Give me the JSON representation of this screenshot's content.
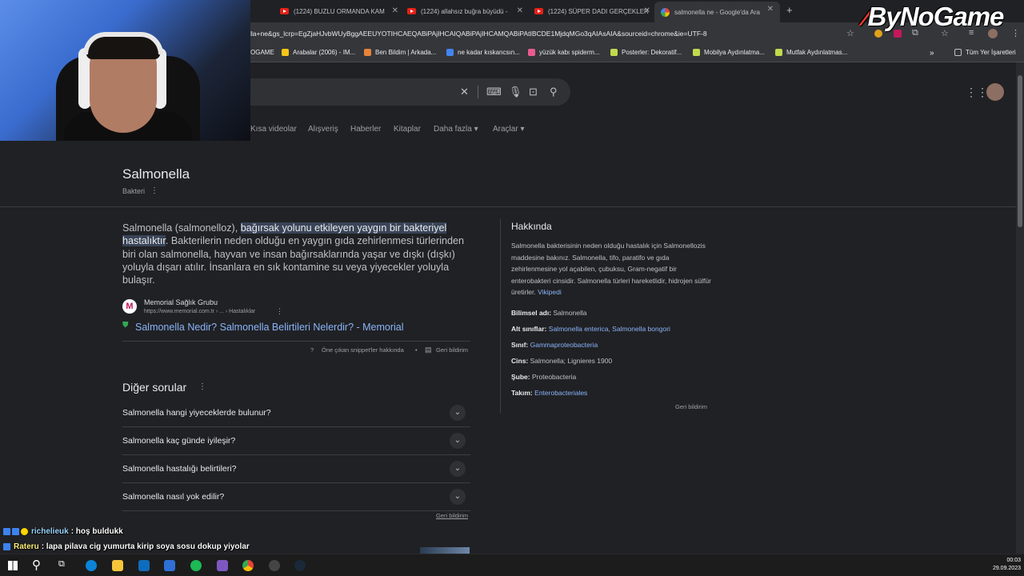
{
  "browser": {
    "tabs": [
      {
        "label": "(1224) BUZLU ORMANDA KAM"
      },
      {
        "label": "(1224) allahsız buğra büyüdü - "
      },
      {
        "label": "(1224) SÜPER DADI GERÇEKLER"
      },
      {
        "label": "salmonella ne - Google'da Ara"
      }
    ],
    "new_tab": "+",
    "url": "lla+ne&gs_lcrp=EgZjaHJvbWUyBggAEEUYOTIHCAEQABiPAjIHCAIQABiPAjIHCAMQABiPAtIBCDE1MjdqMGo3qAIAsAIA&sourceid=chrome&ie=UTF-8",
    "bookmarks": [
      {
        "label": "OGAME",
        "color": "#4a4b4e"
      },
      {
        "label": "Arabalar (2006) - IM...",
        "color": "#f5c518"
      },
      {
        "label": "Ben Bildim | Arkada...",
        "color": "#e8833a"
      },
      {
        "label": "ne kadar kıskancsın...",
        "color": "#4285f4"
      },
      {
        "label": "yüzük kabı spiderm...",
        "color": "#e95b8e"
      },
      {
        "label": "Posterler: Dekoratif...",
        "color": "#c3d94e"
      },
      {
        "label": "Mobilya Aydınlatma...",
        "color": "#c3d94e"
      },
      {
        "label": "Mutfak Aydınlatmas...",
        "color": "#c3d94e"
      }
    ],
    "bookmarks_more": "»",
    "all_bookmarks": "Tüm Yer İşaretleri"
  },
  "search": {
    "nav_tabs": [
      "Kısa videolar",
      "Alışveriş",
      "Haberler",
      "Kitaplar",
      "Daha fazla ▾",
      "Araçlar ▾"
    ]
  },
  "entity": {
    "title": "Salmonella",
    "subtitle": "Bakteri"
  },
  "snippet": {
    "text_before": "Salmonella (salmonelloz), ",
    "text_highlight": "bağırsak yolunu etkileyen yaygın bir bakteriyel hastalıktır",
    "text_after": ". Bakterilerin neden olduğu en yaygın gıda zehirlenmesi türlerinden biri olan salmonella, hayvan ve insan bağırsaklarında yaşar ve dışkı (dışkı) yoluyla dışarı atılır. İnsanlara en sık kontamine su veya yiyecekler yoluyla bulaşır.",
    "source_logo": "M",
    "source_name": "Memorial Sağlık Grubu",
    "source_path": "https://www.memorial.com.tr › ... › Hastalıklar",
    "source_link": "Salmonella Nedir? Salmonella Belirtileri Nelerdir? - Memorial",
    "about_snippets": "Öne çıkan snippet'ler hakkında",
    "feedback": "Geri bildirim"
  },
  "paa": {
    "title": "Diğer sorular",
    "questions": [
      "Salmonella hangi yiyeceklerde bulunur?",
      "Salmonella kaç günde iyileşir?",
      "Salmonella hastalığı belirtileri?",
      "Salmonella nasıl yok edilir?"
    ],
    "feedback": "Geri bildirim"
  },
  "knowledge_panel": {
    "title": "Hakkında",
    "description": "Salmonella bakterisinin neden olduğu hastalık için Salmonellozis maddesine bakınız. Salmonella, tifo, paratifo ve gıda zehirlenmesine yol açabilen, çubuksu, Gram-negatif bir enterobakteri cinsidir. Salmonella türleri hareketlidir, hidrojen sülfür üretirler.",
    "wiki_link": "Vikipedi",
    "rows": [
      {
        "key": "Bilimsel adı:",
        "value": "Salmonella",
        "link": false
      },
      {
        "key": "Alt sınıflar:",
        "value": "Salmonella enterica, Salmonella bongori",
        "link": true
      },
      {
        "key": "Sınıf:",
        "value": "Gammaproteobacteria",
        "link": true
      },
      {
        "key": "Cins:",
        "value": "Salmonella; Lignieres 1900",
        "link": false
      },
      {
        "key": "Şube:",
        "value": "Proteobacteria",
        "link": false
      },
      {
        "key": "Takım:",
        "value": "Enterobacteriales",
        "link": true
      }
    ],
    "feedback": "Geri bildirim"
  },
  "overlay": {
    "logo_text": "ByNoGame",
    "chat": [
      {
        "user": "richelieuk",
        "message": ": hoş buldukk"
      },
      {
        "user": "Rateru",
        "message": ": lapa pilava cig yumurta kirip soya sosu dokup yiyolar"
      }
    ]
  },
  "taskbar": {
    "time": "00:03",
    "date": "29.09.2023"
  }
}
